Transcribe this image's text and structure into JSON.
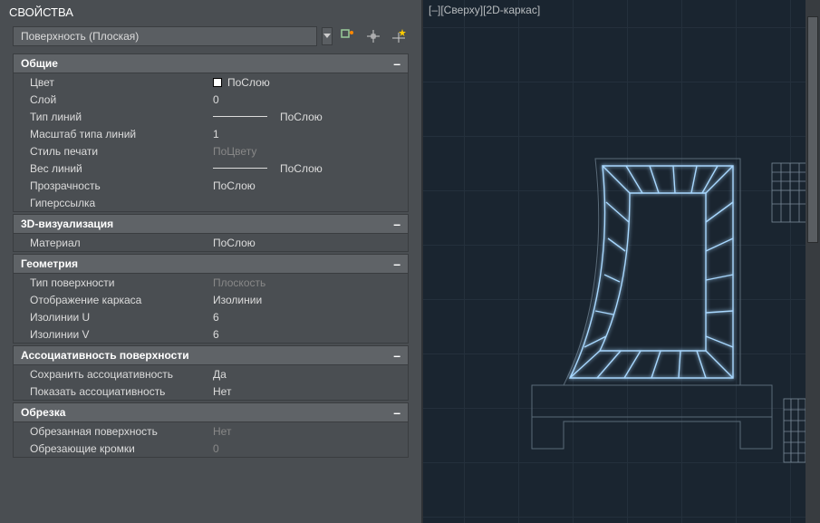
{
  "panel": {
    "title": "СВОЙСТВА"
  },
  "selector": {
    "value": "Поверхность (Плоская)"
  },
  "viewport": {
    "label": "[–][Сверху][2D-каркас]"
  },
  "sections": {
    "general": {
      "title": "Общие",
      "color_label": "Цвет",
      "color_value": "ПоСлою",
      "layer_label": "Слой",
      "layer_value": "0",
      "linetype_label": "Тип линий",
      "linetype_value": "ПоСлою",
      "ltscale_label": "Масштаб типа линий",
      "ltscale_value": "1",
      "plotstyle_label": "Стиль печати",
      "plotstyle_value": "ПоЦвету",
      "lineweight_label": "Вес линий",
      "lineweight_value": "ПоСлою",
      "transparency_label": "Прозрачность",
      "transparency_value": "ПоСлою",
      "hyperlink_label": "Гиперссылка",
      "hyperlink_value": ""
    },
    "viz3d": {
      "title": "3D-визуализация",
      "material_label": "Материал",
      "material_value": "ПоСлою"
    },
    "geometry": {
      "title": "Геометрия",
      "surftype_label": "Тип поверхности",
      "surftype_value": "Плоскость",
      "wireframe_label": "Отображение каркаса",
      "wireframe_value": "Изолинии",
      "isou_label": "Изолинии U",
      "isou_value": "6",
      "isov_label": "Изолинии V",
      "isov_value": "6"
    },
    "assoc": {
      "title": "Ассоциативность поверхности",
      "keep_label": "Сохранить ассоциативность",
      "keep_value": "Да",
      "show_label": "Показать ассоциативность",
      "show_value": "Нет"
    },
    "trim": {
      "title": "Обрезка",
      "trimmed_label": "Обрезанная поверхность",
      "trimmed_value": "Нет",
      "edges_label": "Обрезающие кромки",
      "edges_value": "0"
    }
  }
}
